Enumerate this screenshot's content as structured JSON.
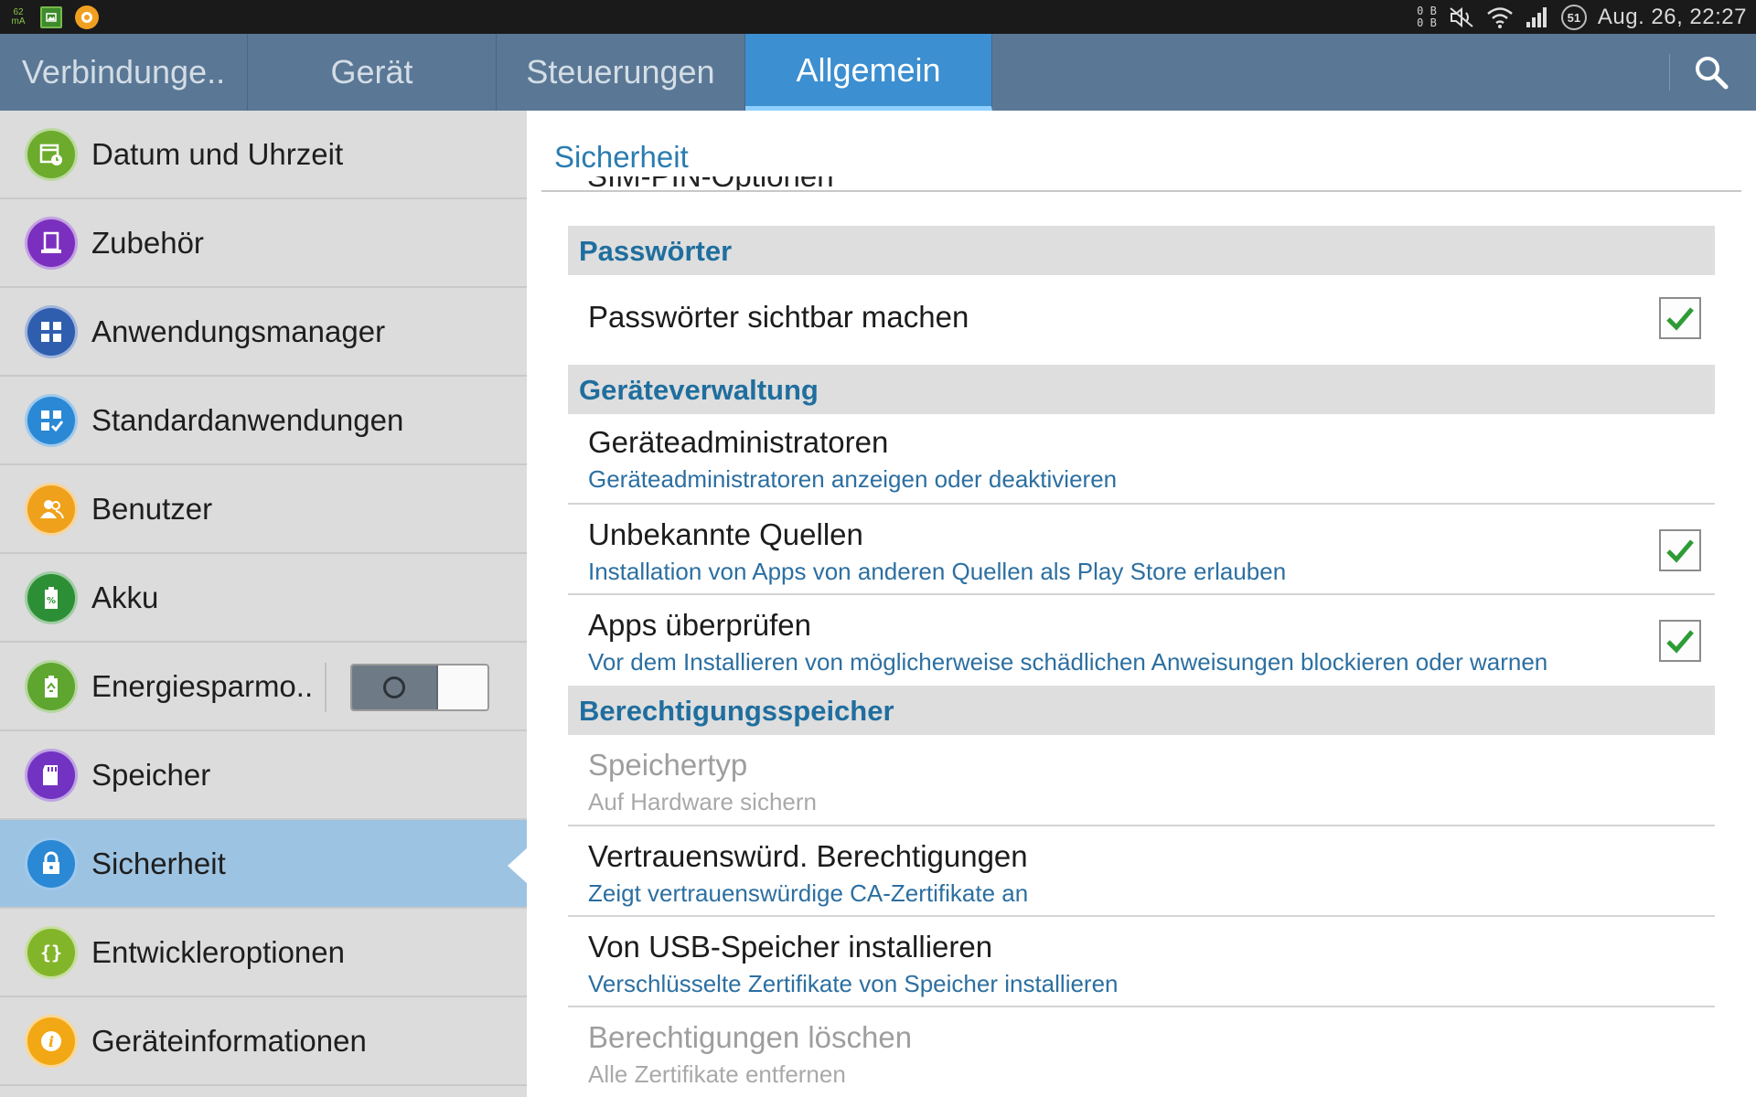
{
  "status_bar": {
    "notif_mini": "62",
    "notif_mini_sub": "mA",
    "data_up": "0 B",
    "data_down": "0 B",
    "battery_level": "51",
    "datetime": "Aug. 26, 22:27"
  },
  "tabs": [
    {
      "label": "Verbindunge.."
    },
    {
      "label": "Gerät"
    },
    {
      "label": "Steuerungen"
    },
    {
      "label": "Allgemein"
    }
  ],
  "active_tab": "Allgemein",
  "sidebar": {
    "items": [
      {
        "label": "Datum und Uhrzeit",
        "icon": "calendar-clock-icon",
        "color": "#6cab2c"
      },
      {
        "label": "Zubehör",
        "icon": "accessory-icon",
        "color": "#7b2fbf"
      },
      {
        "label": "Anwendungsmanager",
        "icon": "apps-grid-icon",
        "color": "#2f5eaf"
      },
      {
        "label": "Standardanwendungen",
        "icon": "default-apps-icon",
        "color": "#2a88d4"
      },
      {
        "label": "Benutzer",
        "icon": "users-icon",
        "color": "#f0a11b"
      },
      {
        "label": "Akku",
        "icon": "battery-icon",
        "color": "#2d8f35"
      },
      {
        "label": "Energiesparmo..",
        "icon": "power-saving-icon",
        "color": "#5ea62f",
        "toggle_on": false
      },
      {
        "label": "Speicher",
        "icon": "sd-card-icon",
        "color": "#7233c2"
      },
      {
        "label": "Sicherheit",
        "icon": "lock-icon",
        "color": "#2a88d4",
        "selected": true
      },
      {
        "label": "Entwickleroptionen",
        "icon": "braces-icon",
        "color": "#83b52a"
      },
      {
        "label": "Geräteinformationen",
        "icon": "info-icon",
        "color": "#f2a814"
      }
    ]
  },
  "main": {
    "title": "Sicherheit",
    "cutoff_text": "SIM-PIN-Optionen",
    "sections": [
      {
        "header": "Passwörter",
        "rows": [
          {
            "title": "Passwörter sichtbar machen",
            "checked": true
          }
        ]
      },
      {
        "header": "Geräteverwaltung",
        "rows": [
          {
            "title": "Geräteadministratoren",
            "subtitle": "Geräteadministratoren anzeigen oder deaktivieren"
          },
          {
            "title": "Unbekannte Quellen",
            "subtitle": "Installation von Apps von anderen Quellen als Play Store erlauben",
            "checked": true
          },
          {
            "title": "Apps überprüfen",
            "subtitle": "Vor dem Installieren von möglicherweise schädlichen Anweisungen blockieren oder warnen",
            "checked": true
          }
        ]
      },
      {
        "header": "Berechtigungsspeicher",
        "rows": [
          {
            "title": "Speichertyp",
            "subtitle": "Auf Hardware sichern",
            "disabled": true
          },
          {
            "title": "Vertrauenswürd. Berechtigungen",
            "subtitle": "Zeigt vertrauenswürdige CA-Zertifikate an"
          },
          {
            "title": "Von USB-Speicher installieren",
            "subtitle": "Verschlüsselte Zertifikate von Speicher installieren"
          },
          {
            "title": "Berechtigungen löschen",
            "subtitle": "Alle Zertifikate entfernen",
            "disabled": true
          }
        ]
      }
    ]
  },
  "colors": {
    "accent": "#3c8fd0",
    "tabbar": "#5a7895",
    "section_text": "#1f6e9e",
    "subtitle_text": "#2c6fa1",
    "check_green": "#2e9c36"
  }
}
